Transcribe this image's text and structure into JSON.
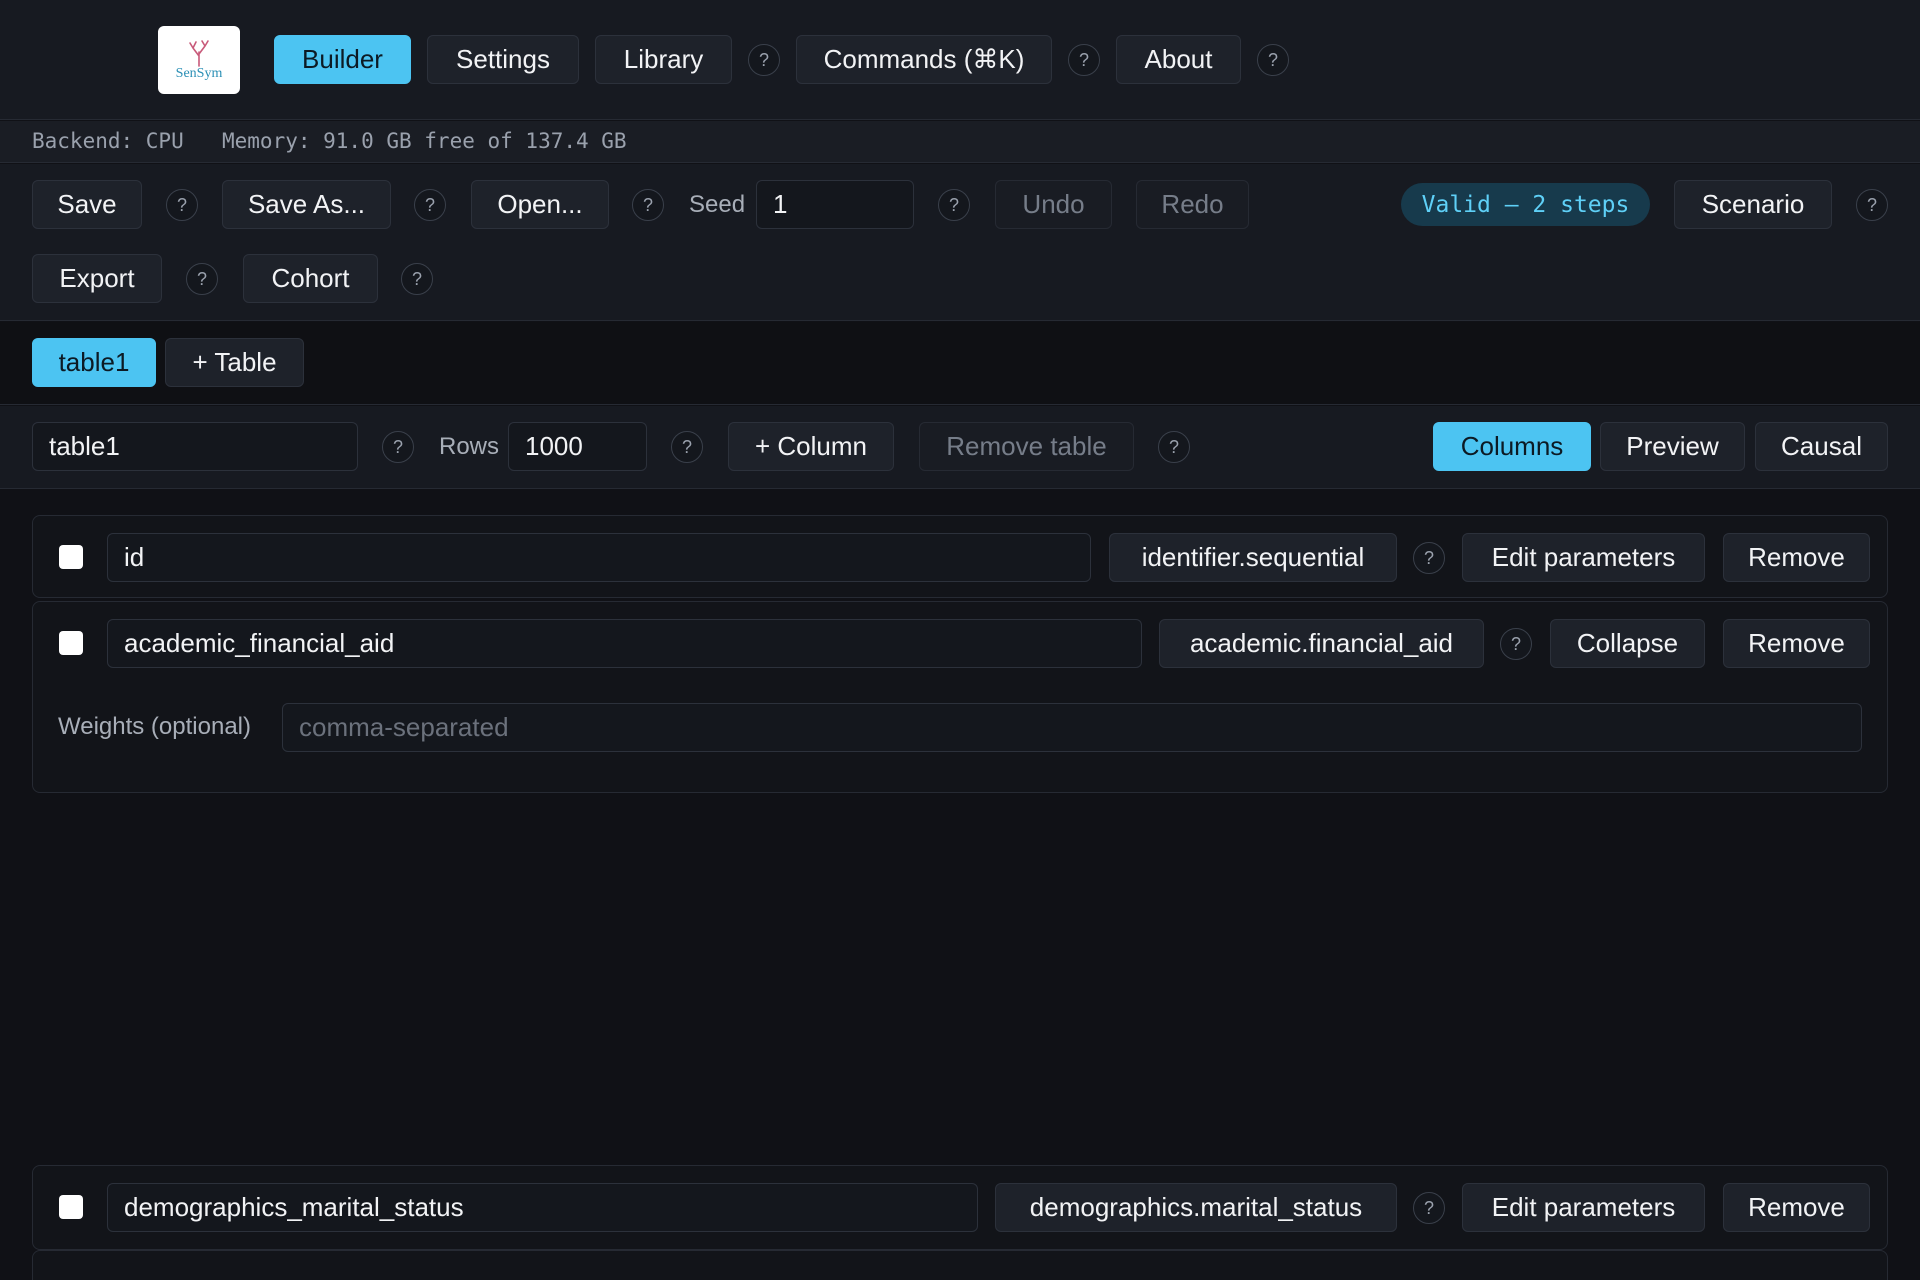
{
  "nav": {
    "logo_text": "SenSym",
    "builder": "Builder",
    "settings": "Settings",
    "library": "Library",
    "commands": "Commands (⌘K)",
    "about": "About",
    "help": "?"
  },
  "status": {
    "backend": "Backend: CPU",
    "memory": "Memory: 91.0 GB free of 137.4 GB"
  },
  "toolbar": {
    "save": "Save",
    "save_as": "Save As...",
    "open": "Open...",
    "seed_label": "Seed",
    "seed_value": "1",
    "undo": "Undo",
    "redo": "Redo",
    "valid_badge": "Valid — 2 steps",
    "scenario": "Scenario",
    "export": "Export",
    "cohort": "Cohort"
  },
  "tabs": {
    "active": "table1",
    "add": "+ Table"
  },
  "table_bar": {
    "name_value": "table1",
    "rows_label": "Rows",
    "rows_value": "1000",
    "add_column": "+ Column",
    "remove_table": "Remove table",
    "view_columns": "Columns",
    "view_preview": "Preview",
    "view_causal": "Causal"
  },
  "columns": [
    {
      "name": "id",
      "generator": "identifier.sequential",
      "action": "Edit parameters",
      "remove": "Remove"
    },
    {
      "name": "academic_financial_aid",
      "generator": "academic.financial_aid",
      "action": "Collapse",
      "remove": "Remove",
      "weights_label": "Weights (optional)",
      "weights_placeholder": "comma-separated"
    },
    {
      "name": "demographics_marital_status",
      "generator": "demographics.marital_status",
      "action": "Edit parameters",
      "remove": "Remove"
    }
  ],
  "colors": {
    "accent": "#4cc4f2",
    "background": "#101116",
    "badge_bg": "#173a4c",
    "badge_text": "#5fd0f7"
  }
}
